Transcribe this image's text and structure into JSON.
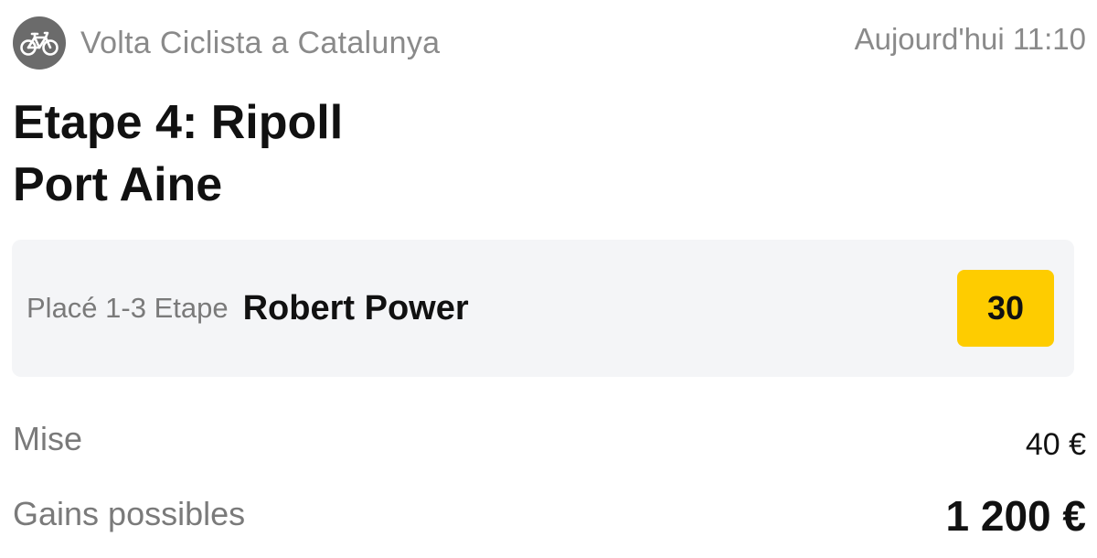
{
  "header": {
    "sport_icon": "bicycle-icon",
    "competition": "Volta Ciclista a Catalunya",
    "datetime": "Aujourd'hui 11:10"
  },
  "event": {
    "title": "Etape 4: Ripoll\nPort Aine"
  },
  "selection": {
    "market": "Placé 1-3 Etape",
    "name": "Robert Power",
    "odds": "30",
    "odds_color": "#fecc00"
  },
  "stake": {
    "label": "Mise",
    "value": "40 €"
  },
  "potential_win": {
    "label": "Gains possibles",
    "value": "1 200 €"
  }
}
